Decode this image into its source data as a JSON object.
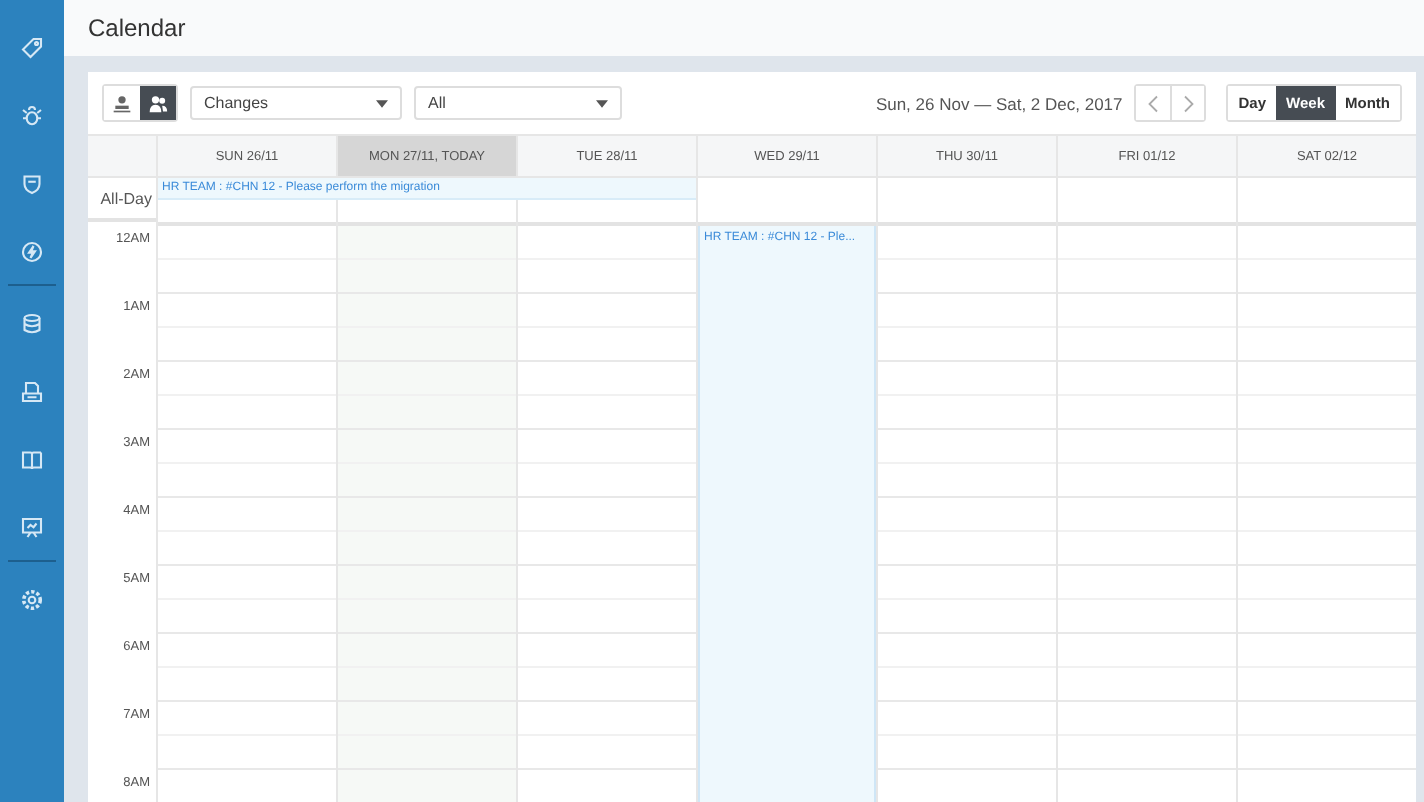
{
  "sidebar": {
    "items": [
      {
        "kind": "tag",
        "selected": false
      },
      {
        "kind": "bug",
        "selected": false
      },
      {
        "kind": "shield",
        "selected": false
      },
      {
        "kind": "bolt",
        "selected": false
      },
      {
        "kind": "database",
        "selected": false
      },
      {
        "kind": "document",
        "selected": false
      },
      {
        "kind": "book",
        "selected": false
      },
      {
        "kind": "board",
        "selected": false
      },
      {
        "kind": "gear",
        "selected": false
      }
    ]
  },
  "header": {
    "title": "Calendar"
  },
  "toolbar": {
    "scope_toggle": [
      {
        "kind": "single",
        "selected": false
      },
      {
        "kind": "group",
        "selected": true
      }
    ],
    "filters": [
      {
        "value": "Changes"
      },
      {
        "value": "All"
      }
    ],
    "range": "Sun, 26 Nov — Sat, 2 Dec, 2017",
    "views": [
      {
        "label": "Day",
        "selected": false
      },
      {
        "label": "Week",
        "selected": true
      },
      {
        "label": "Month",
        "selected": false
      }
    ]
  },
  "calendar": {
    "all_day_label": "All-Day",
    "days": [
      {
        "label": "SUN 26/11",
        "today": false,
        "all_day_events": [
          {
            "text": "HR TEAM : #CHN 12 - Please perform the migration"
          }
        ]
      },
      {
        "label": "MON 27/11, TODAY",
        "today": true
      },
      {
        "label": "TUE 28/11",
        "today": false
      },
      {
        "label": "WED 29/11",
        "today": false,
        "events": [
          {
            "text": "HR TEAM : #CHN 12 - Ple..."
          }
        ]
      },
      {
        "label": "THU 30/11",
        "today": false
      },
      {
        "label": "FRI 01/12",
        "today": false
      },
      {
        "label": "SAT 02/12",
        "today": false
      }
    ],
    "hours": [
      "12AM",
      "1AM",
      "2AM",
      "3AM",
      "4AM",
      "5AM",
      "6AM",
      "7AM",
      "8AM"
    ]
  }
}
